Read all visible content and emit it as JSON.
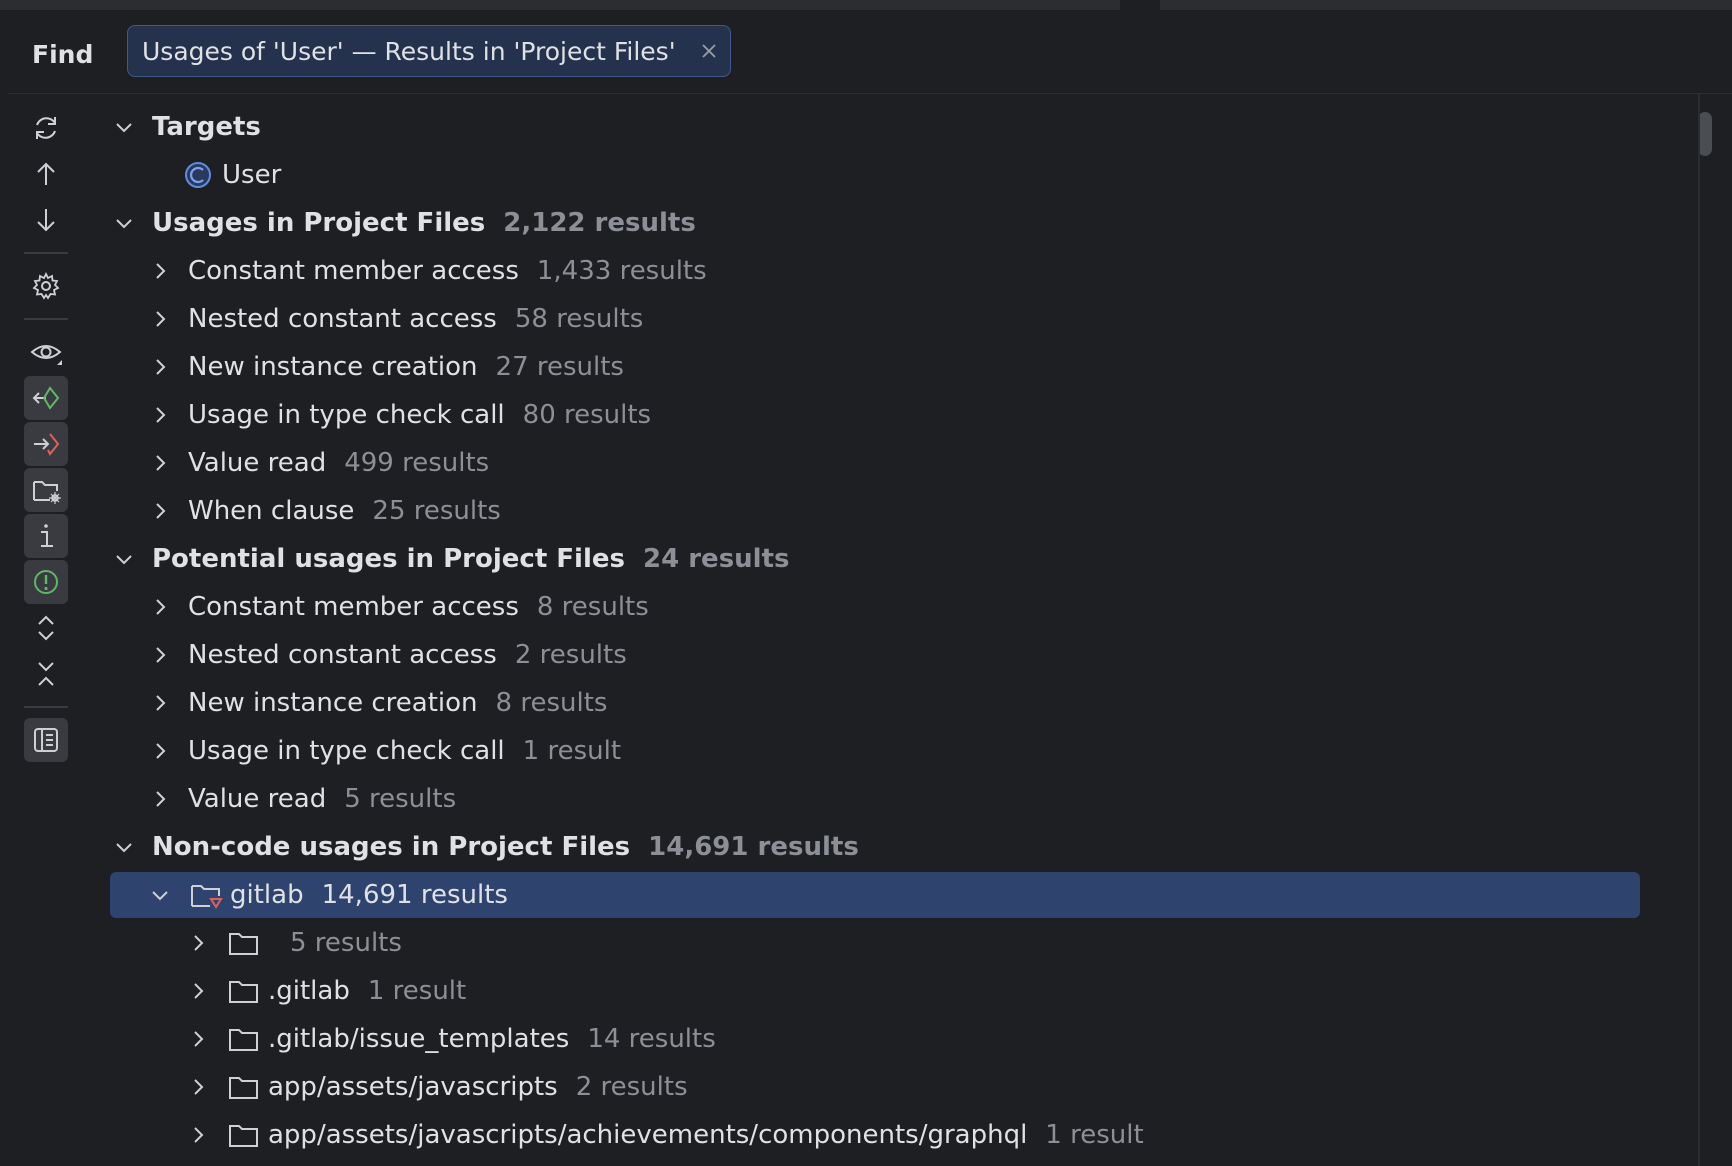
{
  "header": {
    "title": "Find",
    "tab_label": "Usages of 'User' — Results in 'Project Files'"
  },
  "toolbar": {
    "buttons": [
      "rerun-icon",
      "previous-occurrence-icon",
      "next-occurrence-icon",
      "settings-icon",
      "preview-icon",
      "read-access-icon",
      "write-access-icon",
      "group-by-directory-icon",
      "info-icon",
      "show-potential-icon",
      "expand-all-icon",
      "collapse-all-icon",
      "layout-icon"
    ]
  },
  "tree": {
    "targets": {
      "label": "Targets",
      "item": "User"
    },
    "usages": {
      "label": "Usages in Project Files",
      "count": "2,122 results",
      "items": [
        {
          "label": "Constant member access",
          "count": "1,433 results"
        },
        {
          "label": "Nested constant access",
          "count": "58 results"
        },
        {
          "label": "New instance creation",
          "count": "27 results"
        },
        {
          "label": "Usage in type check call",
          "count": "80 results"
        },
        {
          "label": "Value read",
          "count": "499 results"
        },
        {
          "label": "When clause",
          "count": "25 results"
        }
      ]
    },
    "potential": {
      "label": "Potential usages in Project Files",
      "count": "24 results",
      "items": [
        {
          "label": "Constant member access",
          "count": "8 results"
        },
        {
          "label": "Nested constant access",
          "count": "2 results"
        },
        {
          "label": "New instance creation",
          "count": "8 results"
        },
        {
          "label": "Usage in type check call",
          "count": "1 result"
        },
        {
          "label": "Value read",
          "count": "5 results"
        }
      ]
    },
    "noncode": {
      "label": "Non-code usages in Project Files",
      "count": "14,691 results",
      "module": {
        "label": "gitlab",
        "count": "14,691 results"
      },
      "folders": [
        {
          "label": "",
          "count": "5 results"
        },
        {
          "label": ".gitlab",
          "count": "1 result"
        },
        {
          "label": ".gitlab/issue_templates",
          "count": "14 results"
        },
        {
          "label": "app/assets/javascripts",
          "count": "2 results"
        },
        {
          "label": "app/assets/javascripts/achievements/components/graphql",
          "count": "1 result"
        }
      ]
    }
  },
  "colors": {
    "background": "#1e1f22",
    "selection": "#2e436e",
    "tab_background": "#25324d",
    "class_icon": "#5c8ce6",
    "read_access": "#5fb865",
    "write_access": "#e0605a"
  }
}
